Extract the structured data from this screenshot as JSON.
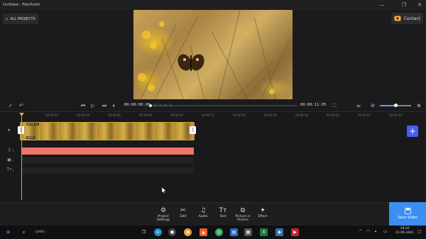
{
  "window": {
    "title": "Untitled - FilmForth",
    "minimize": "—",
    "restore": "❐",
    "close": "✕"
  },
  "header": {
    "back_icon": "‹",
    "back_label": "ALL PROJECTS",
    "contact_label": "Contact",
    "contact_icon": "contact-icon"
  },
  "player": {
    "current_time": "00:00:00.00",
    "total_time": "00:00:11.05",
    "hover_time": "00:00:00.14",
    "progress": 0
  },
  "timeline": {
    "ruler_ticks": [
      "00:00:02",
      "00:00:04",
      "00:00:06",
      "00:00:08",
      "00:00:10",
      "00:00:12",
      "00:00:14",
      "00:00:16",
      "00:00:18",
      "00:00:20",
      "00:00:22",
      "00:00:24"
    ],
    "clip_duration_label": "00:00:11",
    "clip_speed_label": "100%",
    "track_numbers": [
      "1",
      "1",
      "1"
    ],
    "zoom_level": 0.5
  },
  "toolbar": {
    "items": [
      {
        "label": "Project\nSettings",
        "icon": "gear-icon",
        "glyph": "⚙"
      },
      {
        "label": "Edit",
        "icon": "scissors-icon",
        "glyph": "✂"
      },
      {
        "label": "Audio",
        "icon": "music-icon",
        "glyph": "♫"
      },
      {
        "label": "Text",
        "icon": "text-icon",
        "glyph": "Tт"
      },
      {
        "label": "Picture in\nPicture",
        "icon": "pip-icon",
        "glyph": "⧉"
      },
      {
        "label": "Effect",
        "icon": "effect-icon",
        "glyph": "✦"
      }
    ],
    "save_label": "Save Video"
  },
  "taskbar": {
    "search_text": "Links",
    "time": "18:20",
    "date": "21-06-2021",
    "colors": {
      "edge": "#1f8fd6",
      "brave": "#f15a24",
      "chrome": "#34a853",
      "excel": "#1f7a43",
      "filmforth": "#c1272d"
    }
  }
}
